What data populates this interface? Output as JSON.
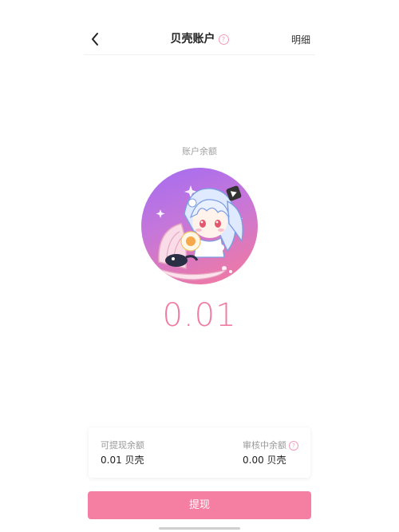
{
  "header": {
    "title": "贝壳账户",
    "detail_label": "明细",
    "help_glyph": "?"
  },
  "balance": {
    "label": "账户余额",
    "amount": "0.01"
  },
  "info_card": {
    "withdrawable_label": "可提现余额",
    "withdrawable_value": "0.01 贝壳",
    "reviewing_label": "审核中余额",
    "reviewing_value": "0.00 贝壳"
  },
  "actions": {
    "withdraw_label": "提现"
  },
  "colors": {
    "accent_pink": "#f47fa3",
    "amount_pink": "#f07aa2",
    "avatar_gradient_start": "#a46cf2",
    "avatar_gradient_end": "#f57a9c"
  },
  "icons": {
    "back": "chevron-left-icon",
    "help": "question-circle-icon"
  }
}
